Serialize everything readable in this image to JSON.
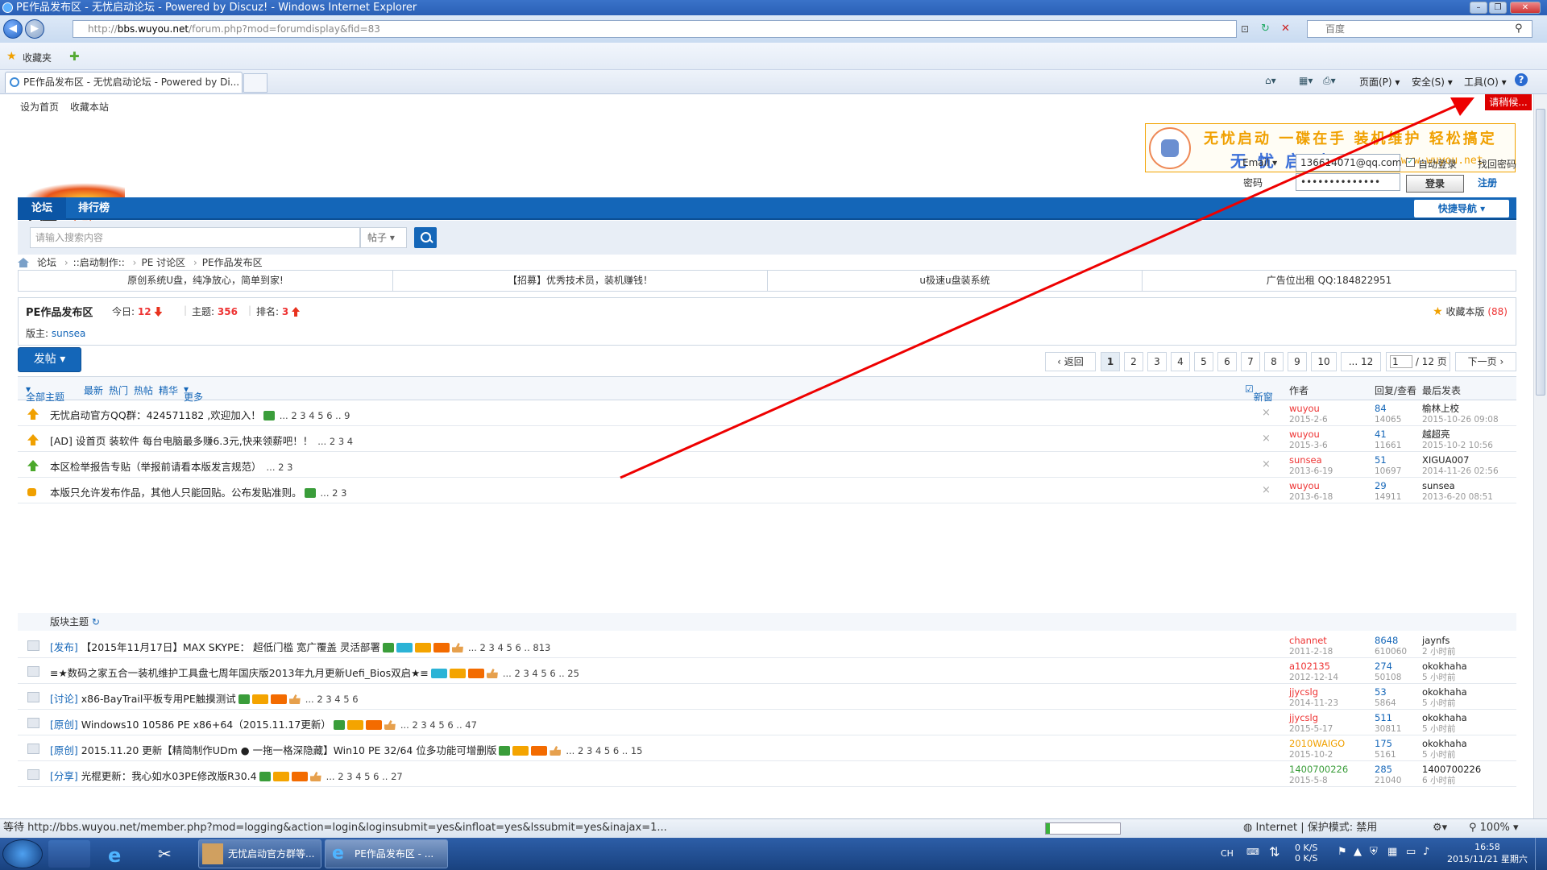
{
  "window": {
    "title": "PE作品发布区 - 无忧启动论坛 - Powered by Discuz! - Windows Internet Explorer"
  },
  "addressbar": {
    "url_prefix": "http://",
    "url_host": "bbs.wuyou.net",
    "url_path": "/forum.php?mod=forumdisplay&fid=83",
    "search_placeholder": "百度"
  },
  "favbar": {
    "favorites": "收藏夹"
  },
  "tab": {
    "title": "PE作品发布区 - 无忧启动论坛 - Powered by Di..."
  },
  "commands": {
    "page": "页面(P)",
    "safety": "安全(S)",
    "tools": "工具(O)"
  },
  "site": {
    "top_links": [
      "设为首页",
      "收藏本站"
    ],
    "waiting": "请稍候...",
    "banner": {
      "line1": "无忧启动 一碟在手 装机维护 轻松搞定",
      "line2": "无忧启动",
      "url": "http://www.wuyou.net"
    },
    "logo": {
      "main": "无忧",
      "sub": "启动"
    },
    "login": {
      "email_label": "Email",
      "email_value": "136614071@qq.com",
      "auto_login": "自动登录",
      "find_pwd": "找回密码",
      "pwd_label": "密码",
      "pwd_value": "••••••••••••••",
      "login_btn": "登录",
      "register": "注册"
    },
    "nav": {
      "forum": "论坛",
      "rank": "排行榜",
      "quicknav": "快捷导航"
    },
    "search": {
      "placeholder": "请输入搜索内容",
      "type": "帖子"
    },
    "breadcrumb": [
      "论坛",
      "::启动制作::",
      "PE 讨论区",
      "PE作品发布区"
    ],
    "ads": [
      "原创系统U盘，纯净放心，简单到家!",
      "【招募】优秀技术员，装机赚钱！",
      "u极速u盘装系统",
      "广告位出租 QQ:184822951"
    ],
    "forum": {
      "name": "PE作品发布区",
      "today_label": "今日:",
      "today": "12",
      "threads_label": "主题:",
      "threads": "356",
      "rank_label": "排名:",
      "rank": "3",
      "moderator_label": "版主:",
      "moderator": "sunsea",
      "favorite": "收藏本版",
      "favorite_count": "(88)"
    },
    "post_btn": "发帖",
    "pager": {
      "back": "返回",
      "pages": [
        "1",
        "2",
        "3",
        "4",
        "5",
        "6",
        "7",
        "8",
        "9",
        "10",
        "... 12"
      ],
      "input": "1",
      "total": "/ 12 页",
      "next": "下一页"
    },
    "thead": {
      "all": "全部主题",
      "latest": "最新",
      "hot": "热门",
      "heat": "热帖",
      "digest": "精华",
      "more": "更多",
      "newwin": "新窗",
      "author": "作者",
      "replies": "回复/查看",
      "lastpost": "最后发表"
    },
    "section_label": "版块主题",
    "sticky": [
      {
        "title": "无忧启动官方QQ群：424571182 ,欢迎加入！",
        "pages": "... 2 3 4 5 6 .. 9",
        "author": "wuyou",
        "date": "2015-2-6",
        "replies": "84",
        "views": "14065",
        "last": "榆林上校",
        "last_time": "2015-10-26 09:08"
      },
      {
        "title": "[AD] 设首页 装软件 每台电脑最多赚6.3元,快来领薪吧！！",
        "pages": "... 2 3 4",
        "author": "wuyou",
        "date": "2015-3-6",
        "replies": "41",
        "views": "11661",
        "last": "越超亮",
        "last_time": "2015-10-2 10:56"
      },
      {
        "title": "本区检举报告专贴（举报前请看本版发言规范）",
        "pages": "... 2 3",
        "author": "sunsea",
        "date": "2013-6-19",
        "replies": "51",
        "views": "10697",
        "last": "XIGUA007",
        "last_time": "2014-11-26 02:56"
      },
      {
        "title": "本版只允许发布作品，其他人只能回贴。公布发贴准则。",
        "pages": "... 2 3",
        "author": "wuyou",
        "date": "2013-6-18",
        "replies": "29",
        "views": "14911",
        "last": "sunsea",
        "last_time": "2013-6-20 08:51"
      }
    ],
    "threads": [
      {
        "tag": "[发布]",
        "title": "【2015年11月17日】MAX SKYPE： 超低门槛 宽广覆盖 灵活部署",
        "pages": "... 2 3 4 5 6 .. 813",
        "author": "channet",
        "author_color": "#e33",
        "date": "2011-2-18",
        "replies": "8648",
        "views": "610060",
        "last": "jaynfs",
        "last_time": "2 小时前"
      },
      {
        "tag": "",
        "title": "≡★数码之家五合一装机维护工具盘七周年国庆版2013年九月更新Uefi_Bios双启★≡",
        "pages": "... 2 3 4 5 6 .. 25",
        "author": "a102135",
        "author_color": "#e33",
        "date": "2012-12-14",
        "replies": "274",
        "views": "50108",
        "last": "okokhaha",
        "last_time": "5 小时前"
      },
      {
        "tag": "[讨论]",
        "title": "x86-BayTrail平板专用PE触摸测试",
        "pages": "... 2 3 4 5 6",
        "author": "jjycslg",
        "author_color": "#e33",
        "date": "2014-11-23",
        "replies": "53",
        "views": "5864",
        "last": "okokhaha",
        "last_time": "5 小时前"
      },
      {
        "tag": "[原创]",
        "title": "Windows10 10586 PE x86+64（2015.11.17更新）",
        "pages": "... 2 3 4 5 6 .. 47",
        "author": "jjycslg",
        "author_color": "#e33",
        "date": "2015-5-17",
        "replies": "511",
        "views": "30811",
        "last": "okokhaha",
        "last_time": "5 小时前"
      },
      {
        "tag": "[原创]",
        "title": "2015.11.20 更新【精简制作UDm ● 一拖一格深隐藏】Win10 PE 32/64 位多功能可增删版",
        "pages": "... 2 3 4 5 6 .. 15",
        "author": "2010WAIGO",
        "author_color": "#f0a000",
        "date": "2015-10-2",
        "replies": "175",
        "views": "5161",
        "last": "okokhaha",
        "last_time": "5 小时前"
      },
      {
        "tag": "[分享]",
        "title": "光棍更新：我心如水03PE修改版R30.4",
        "pages": "... 2 3 4 5 6 .. 27",
        "author": "1400700226",
        "author_color": "#3a9d3a",
        "date": "2015-5-8",
        "replies": "285",
        "views": "21040",
        "last": "1400700226",
        "last_time": "6 小时前"
      }
    ]
  },
  "status": {
    "text": "等待 http://bbs.wuyou.net/member.php?mod=logging&action=login&loginsubmit=yes&infloat=yes&lssubmit=yes&inajax=1...",
    "zone": "Internet | 保护模式: 禁用",
    "zoom": "100%"
  },
  "taskbar": {
    "item1": "无忧启动官方群等...",
    "item2": "PE作品发布区 - ...",
    "lang": "CH",
    "net_up": "0 K/S",
    "net_down": "0 K/S",
    "time": "16:58",
    "date": "2015/11/21 星期六"
  }
}
